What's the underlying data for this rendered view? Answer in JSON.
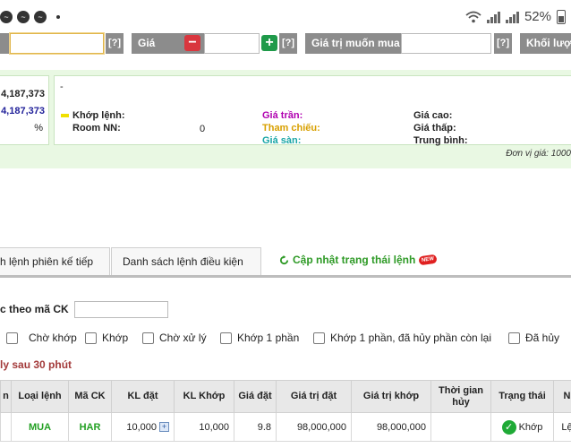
{
  "status_bar": {
    "battery": "52%"
  },
  "order_bar": {
    "help": "[?]",
    "price_label": "Giá",
    "minus": "−",
    "plus": "+",
    "value_label": "Giá trị muốn mua",
    "volume_label": "Khối lượng"
  },
  "info": {
    "left_value_1": "4,187,373",
    "left_value_2": "4,187,373",
    "left_pct": "%",
    "dash": "-",
    "match_label": "Khớp lệnh:",
    "foreign_room_label": "Room NN:",
    "foreign_room_value": "0",
    "ceiling_label": "Giá trần:",
    "reference_label": "Tham chiếu:",
    "floor_label": "Giá sàn:",
    "high_label": "Giá cao:",
    "low_label": "Giá thấp:",
    "avg_label": "Trung bình:",
    "unit": "Đơn vị giá: 1000",
    "colors": {
      "ceiling": "#b000b0",
      "reference": "#d8a000",
      "floor": "#18a6a6"
    }
  },
  "tabs": {
    "next_session": "h lệnh phiên kế tiếp",
    "conditional": "Danh sách lệnh điều kiện",
    "refresh": "Cập nhật trạng thái lệnh",
    "new_badge": "NEW"
  },
  "filter": {
    "label": "c theo mã CK",
    "checkboxes": [
      "Chờ khớp",
      "Khớp",
      "Chờ xử lý",
      "Khớp 1 phần",
      "Khớp 1 phần, đã hủy phần còn lại",
      "Đã hủy"
    ],
    "warning": "ly sau 30 phút"
  },
  "table": {
    "headers": [
      "n",
      "Loại lệnh",
      "Mã CK",
      "KL đặt",
      "KL Khớp",
      "Giá đặt",
      "Giá trị đặt",
      "Giá trị khớp",
      "Thời gian hủy",
      "Trạng thái",
      "N"
    ],
    "row": {
      "side": "MUA",
      "symbol": "HAR",
      "qty": "10,000",
      "qty_plus": "+",
      "matched_qty": "10,000",
      "price": "9.8",
      "order_value": "98,000,000",
      "matched_value": "98,000,000",
      "cancel_time": "",
      "status_check": "✓",
      "status": "Khớp",
      "last": "Lệ"
    }
  }
}
